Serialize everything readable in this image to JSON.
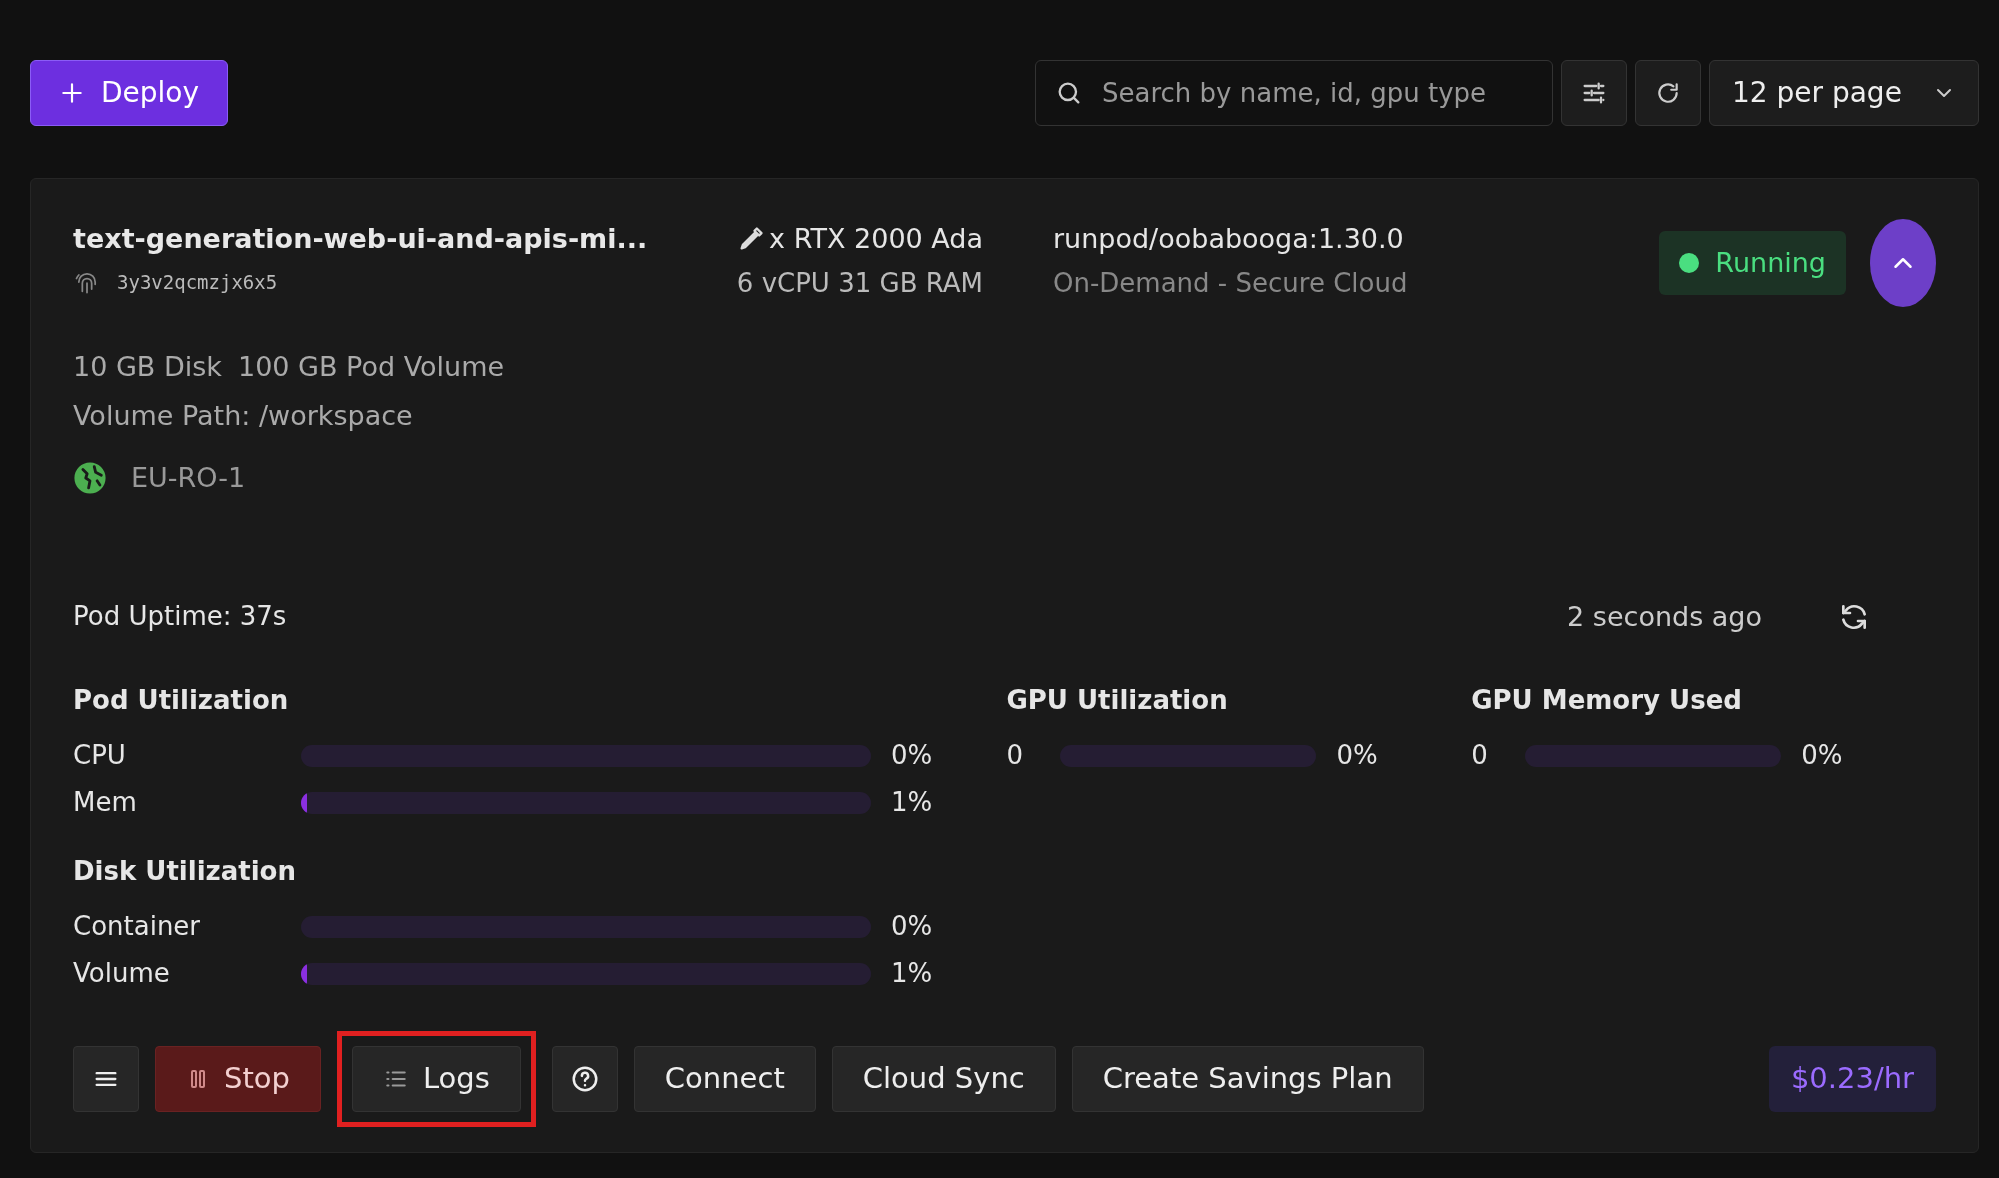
{
  "toolbar": {
    "deploy_label": "Deploy",
    "search": {
      "placeholder": "Search by name, id, gpu type"
    },
    "per_page": "12 per page"
  },
  "pod": {
    "name": "text-generation-web-ui-and-apis-mi...",
    "id": "3y3v2qcmzjx6x5",
    "gpu": "x RTX 2000 Ada",
    "specs": "6 vCPU 31 GB RAM",
    "image": "runpod/oobabooga:1.30.0",
    "plan": "On-Demand - Secure Cloud",
    "status": "Running",
    "expanded": true,
    "storage": [
      "10 GB Disk",
      "100 GB Pod Volume"
    ],
    "volume_path": "Volume Path: /workspace",
    "region": "EU-RO-1",
    "uptime": "Pod Uptime: 37s",
    "updated": "2 seconds ago",
    "pod_utilization": {
      "title": "Pod Utilization",
      "meters": [
        {
          "label": "CPU",
          "level": 0,
          "reading": "0%"
        },
        {
          "label": "Mem",
          "level": 0.01,
          "reading": "1%"
        }
      ]
    },
    "gpu_utilization": {
      "title": "GPU Utilization",
      "index": "0",
      "level": 0,
      "reading": "0%"
    },
    "gpu_memory": {
      "title": "GPU Memory Used",
      "index": "0",
      "level": 0,
      "reading": "0%"
    },
    "disk_utilization": {
      "title": "Disk Utilization",
      "meters": [
        {
          "label": "Container",
          "level": 0,
          "reading": "0%"
        },
        {
          "label": "Volume",
          "level": 0.01,
          "reading": "1%"
        }
      ]
    },
    "actions": [
      {
        "kind": "menu",
        "highlighted": false
      },
      {
        "kind": "stop",
        "label": "Stop",
        "highlighted": false
      },
      {
        "kind": "logs",
        "label": "Logs",
        "highlighted": true
      },
      {
        "kind": "help",
        "highlighted": false
      },
      {
        "kind": "plain",
        "label": "Connect",
        "highlighted": false
      },
      {
        "kind": "plain",
        "label": "Cloud Sync",
        "highlighted": false
      },
      {
        "kind": "plain",
        "label": "Create Savings Plan",
        "highlighted": false
      }
    ],
    "price": "$0.23/hr"
  }
}
